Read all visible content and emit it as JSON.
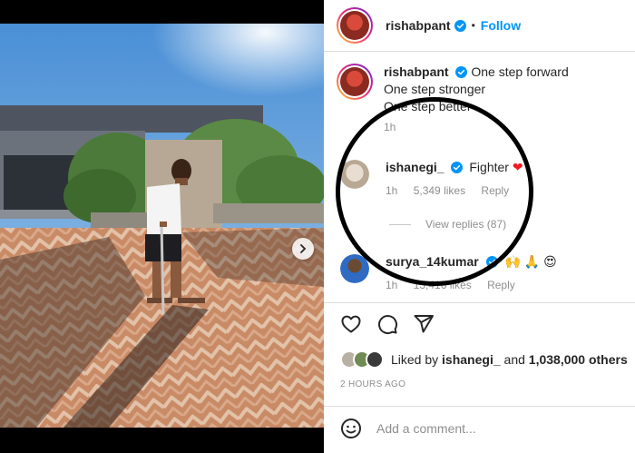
{
  "post": {
    "username": "rishabpant",
    "follow_label": "Follow",
    "separator": "•"
  },
  "caption": {
    "username": "rishabpant",
    "lines": [
      "One step forward",
      "One step stronger",
      "One step better"
    ],
    "time": "1h"
  },
  "comments": [
    {
      "username": "ishanegi_",
      "text": "Fighter",
      "emoji": "❤",
      "time": "1h",
      "likes": "5,349 likes",
      "reply_label": "Reply",
      "view_replies": "View replies (87)"
    },
    {
      "username": "surya_14kumar",
      "emoji": "🙌 🙏 😍",
      "time": "1h",
      "likes": "13,416 likes",
      "reply_label": "Reply"
    }
  ],
  "likes": {
    "prefix": "Liked by",
    "user": "ishanegi_",
    "connector": "and",
    "others": "1,038,000 others"
  },
  "timestamp": "2 HOURS AGO",
  "add_comment": {
    "placeholder": "Add a comment..."
  },
  "icons": {
    "verified": "verified-badge-icon",
    "like": "heart-icon",
    "comment": "comment-icon",
    "share": "share-icon",
    "emoji": "smiley-icon",
    "next": "chevron-right-icon"
  },
  "colors": {
    "accent": "#0095f6",
    "text": "#262626",
    "muted": "#8e8e8e",
    "heart": "#ed1c24"
  },
  "carousel": {
    "slides": 2,
    "active": 1
  }
}
